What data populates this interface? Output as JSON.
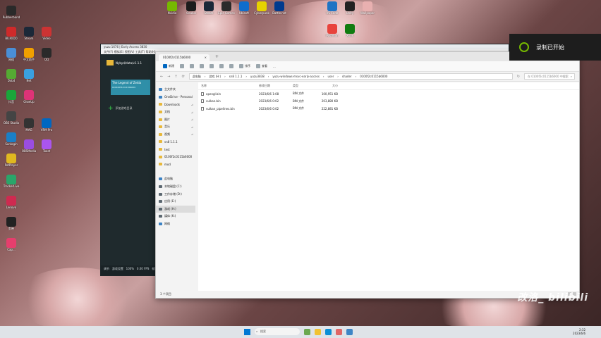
{
  "recording": {
    "text": "录制已开始"
  },
  "bg_app": {
    "title": "yuzu 1676 | Early Access 3830",
    "menu": "文件(F)  模拟(E)  视图(V)  工具(T)  帮助(H)",
    "root_folder": "Nybyd/data/v1.1.1",
    "add_dir": "添加游戏目录",
    "game_title_1": "The Legend of Zelda",
    "game_id": "0x0100f2c0115b6000",
    "status_items": [
      "调节",
      "游戏设置",
      "100%",
      "0.00 FPS",
      "帧: 0.00 ms"
    ]
  },
  "explorer": {
    "tab_title": "0100f2c0115b6000",
    "toolbar": [
      "新建",
      "排序",
      "查看",
      "..."
    ],
    "address": [
      "此电脑",
      "游戏 (H:)",
      "sn8 1.1.1",
      "yuzu3838",
      "yuzu-windows-msvc-early-access",
      "user",
      "shader",
      "0100f2c0115b6000"
    ],
    "search_placeholder": "在 0100f2c0115b6000 中搜索",
    "nav": [
      {
        "label": "主文件夹",
        "kind": "home"
      },
      {
        "label": "OneDrive - Personal",
        "kind": "cloud"
      },
      {
        "label": "Downloads",
        "kind": "folder",
        "pin": true
      },
      {
        "label": "文档",
        "kind": "folder",
        "pin": true
      },
      {
        "label": "图片",
        "kind": "folder",
        "pin": true
      },
      {
        "label": "音乐",
        "kind": "folder",
        "pin": true
      },
      {
        "label": "视频",
        "kind": "folder",
        "pin": true
      },
      {
        "label": "sn8 1.1.1",
        "kind": "folder"
      },
      {
        "label": "test",
        "kind": "folder"
      },
      {
        "label": "0100f2c0115b6000",
        "kind": "folder"
      },
      {
        "label": "mod",
        "kind": "folder"
      },
      {
        "label": "",
        "kind": "spacer"
      },
      {
        "label": "此电脑",
        "kind": "pc"
      },
      {
        "label": "本地磁盘 (C:)",
        "kind": "drive"
      },
      {
        "label": "工作存储 (D:)",
        "kind": "drive"
      },
      {
        "label": "应用 (E:)",
        "kind": "drive"
      },
      {
        "label": "游戏 (H:)",
        "kind": "drive",
        "selected": true
      },
      {
        "label": "媒体 (K:)",
        "kind": "drive"
      },
      {
        "label": "网络",
        "kind": "net"
      }
    ],
    "columns": [
      "名称",
      "修改日期",
      "类型",
      "大小"
    ],
    "files": [
      {
        "name": "opengl.bin",
        "date": "2023/6/6 1:08",
        "type": "BIN 文件",
        "size": "100,951 KB"
      },
      {
        "name": "vulkan.bin",
        "date": "2023/6/6 0:02",
        "type": "BIN 文件",
        "size": "203,880 KB"
      },
      {
        "name": "vulkan_pipelines.bin",
        "date": "2023/6/6 0:02",
        "type": "BIN 文件",
        "size": "222,881 KB"
      }
    ],
    "status": "3 个项目"
  },
  "desktop_icons_left": [
    "Rubberband",
    "BILIKIDO",
    "网络",
    "Dxbd",
    "抖音",
    "OBS Studio",
    "Sunlogin",
    "PotPlayer",
    "TrackerLive",
    "Lenovo",
    "剪映",
    "Cap...",
    "中文助手",
    "Steam",
    "Net",
    "GlowUp",
    "MAG",
    "OBSMedia",
    "QQ",
    "Video",
    "VRM Pro",
    "Toast"
  ],
  "desktop_icons_top": [
    "Nvidia",
    "Oculus",
    "Steam",
    "Epic Games",
    "Ubisoft",
    "Cyberpunk",
    "Battle.net",
    "VS Code",
    "Unity",
    "Wallpaper",
    "Postman",
    "Xbox"
  ],
  "taskbar": {
    "search": "搜索",
    "time": "2:32",
    "date": "2023/6/6"
  },
  "watermark": "改洛_ bilibili"
}
